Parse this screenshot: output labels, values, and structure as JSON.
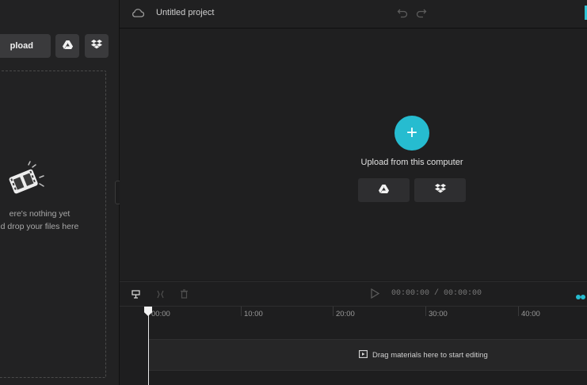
{
  "left_panel": {
    "upload_label": "pload",
    "empty_line1": "ere's nothing yet",
    "empty_line2": "d drop your files here",
    "icons": [
      "google-drive-icon",
      "dropbox-icon",
      "film-clapper-icon"
    ]
  },
  "topbar": {
    "project_title": "Untitled project",
    "icons": [
      "cloud-icon",
      "undo-icon",
      "redo-icon"
    ]
  },
  "preview": {
    "upload_label": "Upload from this computer",
    "plus": "+"
  },
  "timeline": {
    "time_readout": "00:00:00 / 00:00:00",
    "ticks": [
      "00:00",
      "10:00",
      "20:00",
      "30:00",
      "40:00"
    ],
    "drag_hint": "Drag materials here to start editing"
  },
  "colors": {
    "accent": "#26bcd0",
    "background": "#1b1b1c"
  }
}
